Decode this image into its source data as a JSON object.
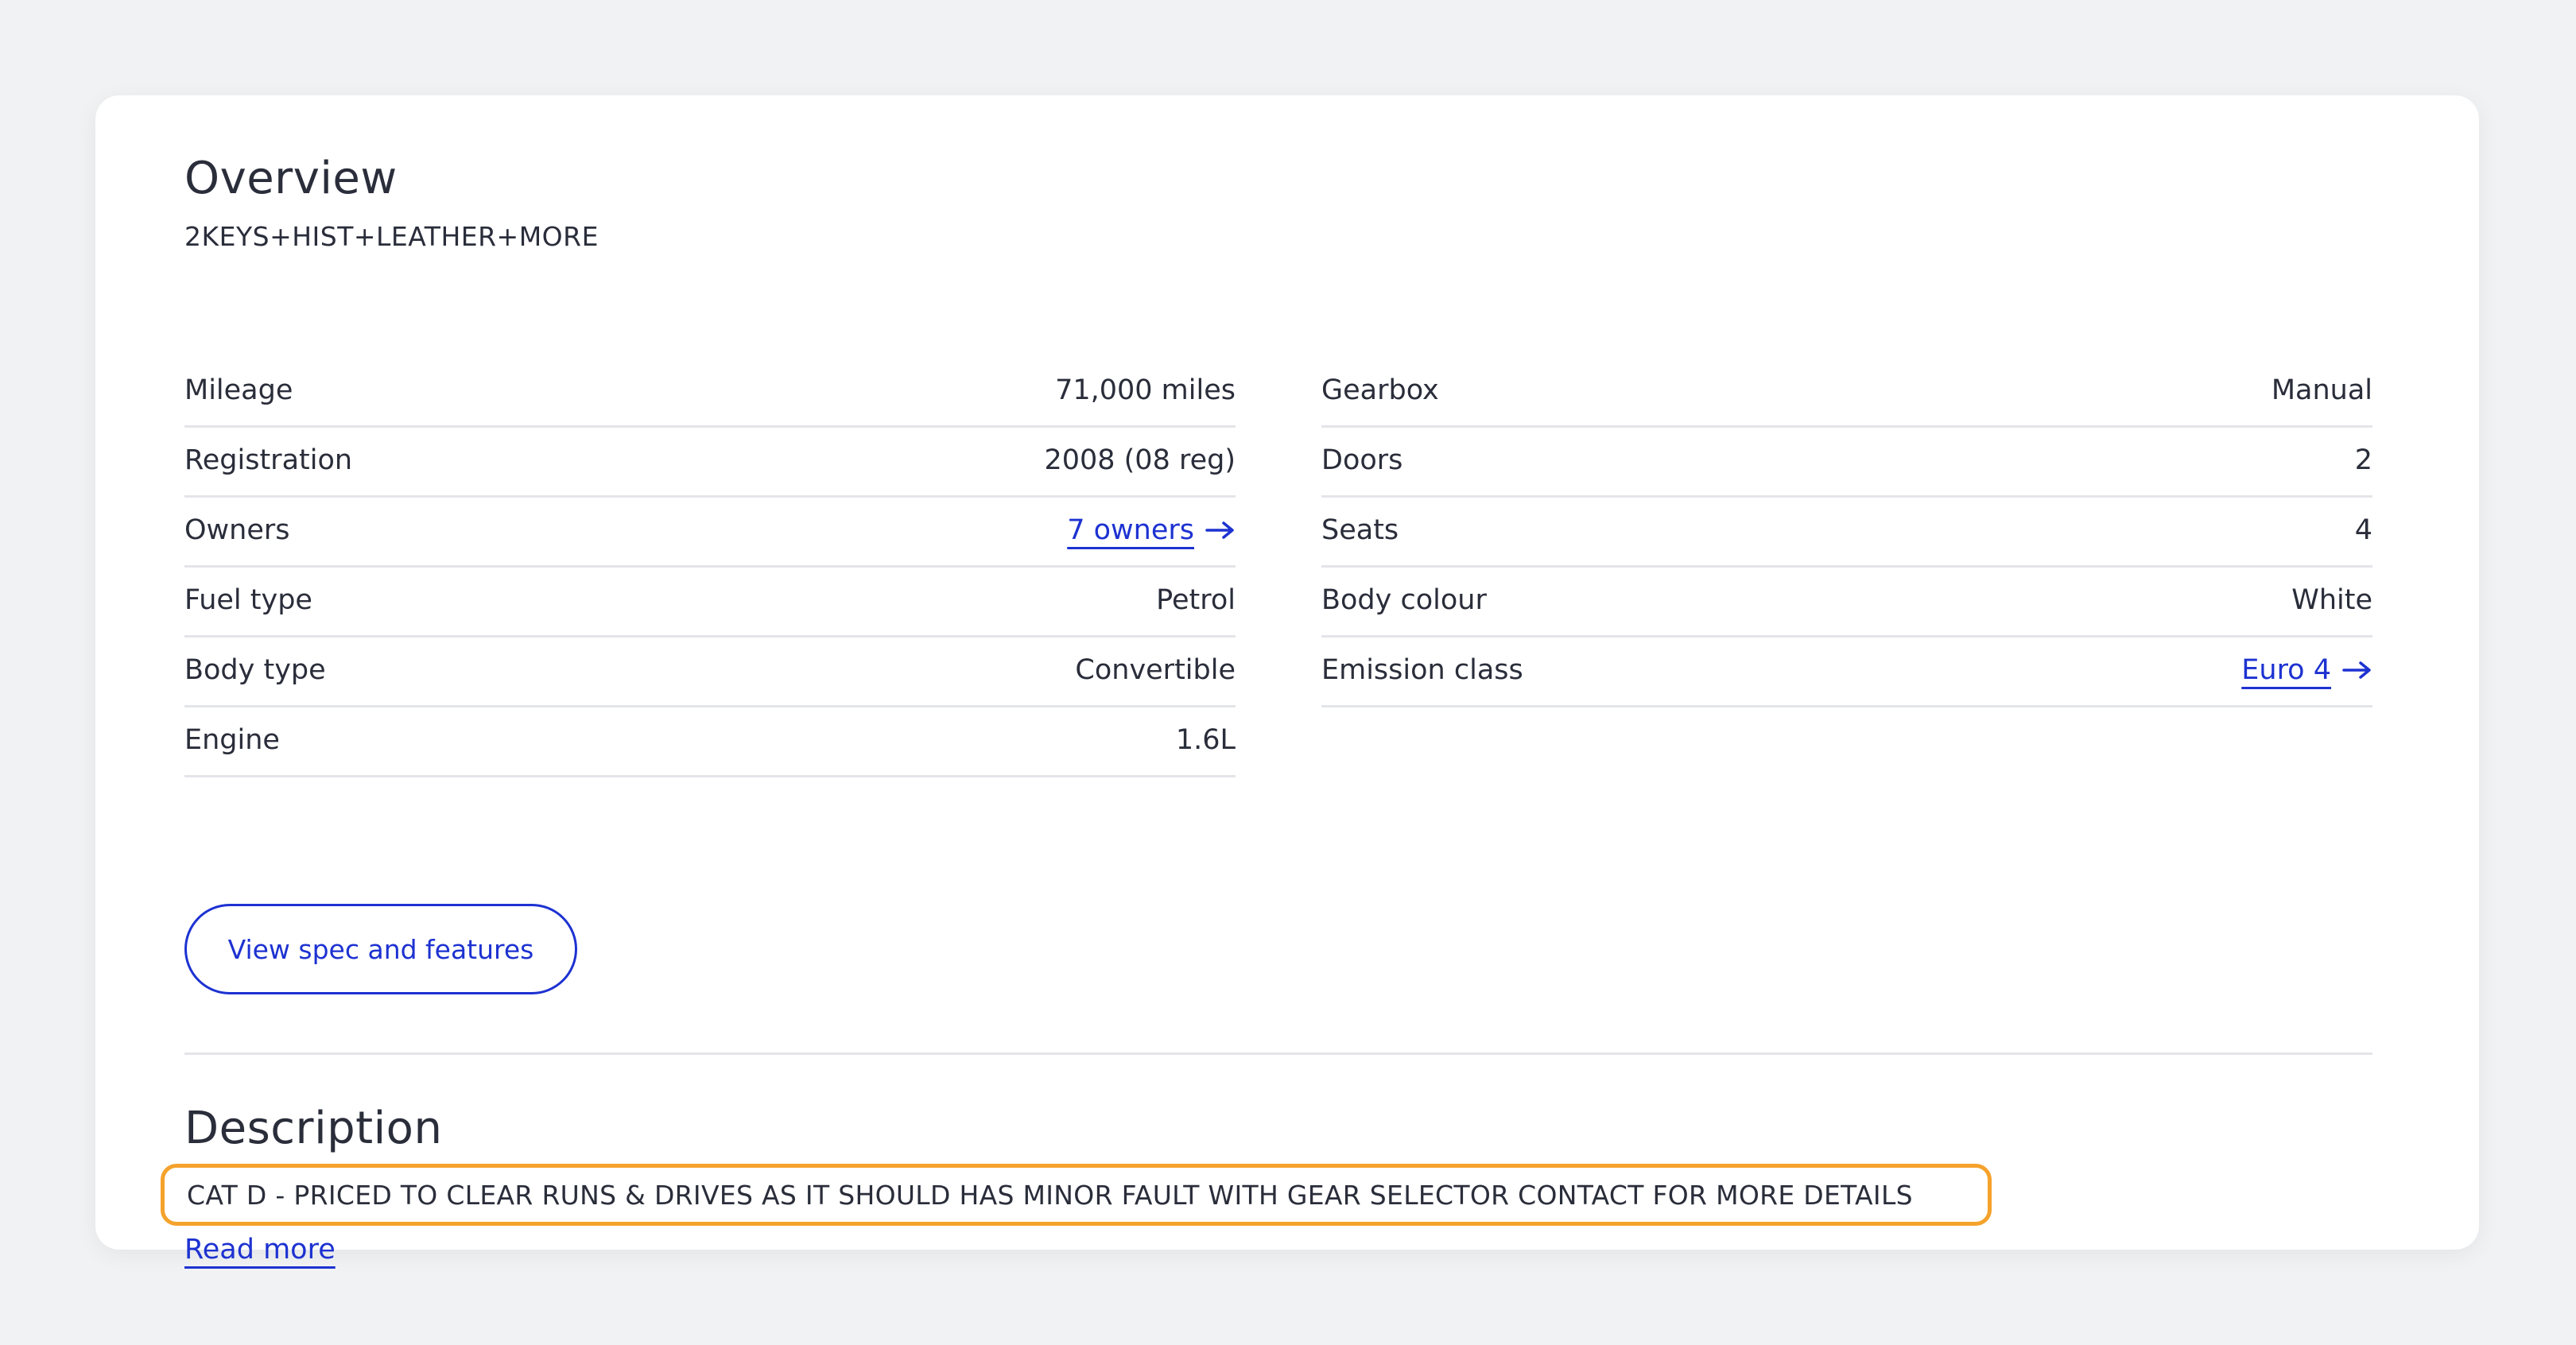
{
  "overview": {
    "title": "Overview",
    "subtitle": "2KEYS+HIST+LEATHER+MORE",
    "left_specs": [
      {
        "label": "Mileage",
        "value": "71,000 miles"
      },
      {
        "label": "Registration",
        "value": "2008 (08 reg)"
      },
      {
        "label": "Owners",
        "value": "7 owners"
      },
      {
        "label": "Fuel type",
        "value": "Petrol"
      },
      {
        "label": "Body type",
        "value": "Convertible"
      },
      {
        "label": "Engine",
        "value": "1.6L"
      }
    ],
    "right_specs": [
      {
        "label": "Gearbox",
        "value": "Manual"
      },
      {
        "label": "Doors",
        "value": "2"
      },
      {
        "label": "Seats",
        "value": "4"
      },
      {
        "label": "Body colour",
        "value": "White"
      },
      {
        "label": "Emission class",
        "value": "Euro 4"
      }
    ],
    "button_label": "View spec and features"
  },
  "description": {
    "title": "Description",
    "text": "CAT D - PRICED TO CLEAR RUNS & DRIVES AS IT SHOULD HAS MINOR FAULT WITH GEAR SELECTOR CONTACT FOR MORE DETAILS",
    "read_more": "Read more"
  },
  "colors": {
    "link": "#1d32d1",
    "highlight_border": "#f5a22c",
    "background": "#f1f2f4",
    "card": "#ffffff"
  }
}
